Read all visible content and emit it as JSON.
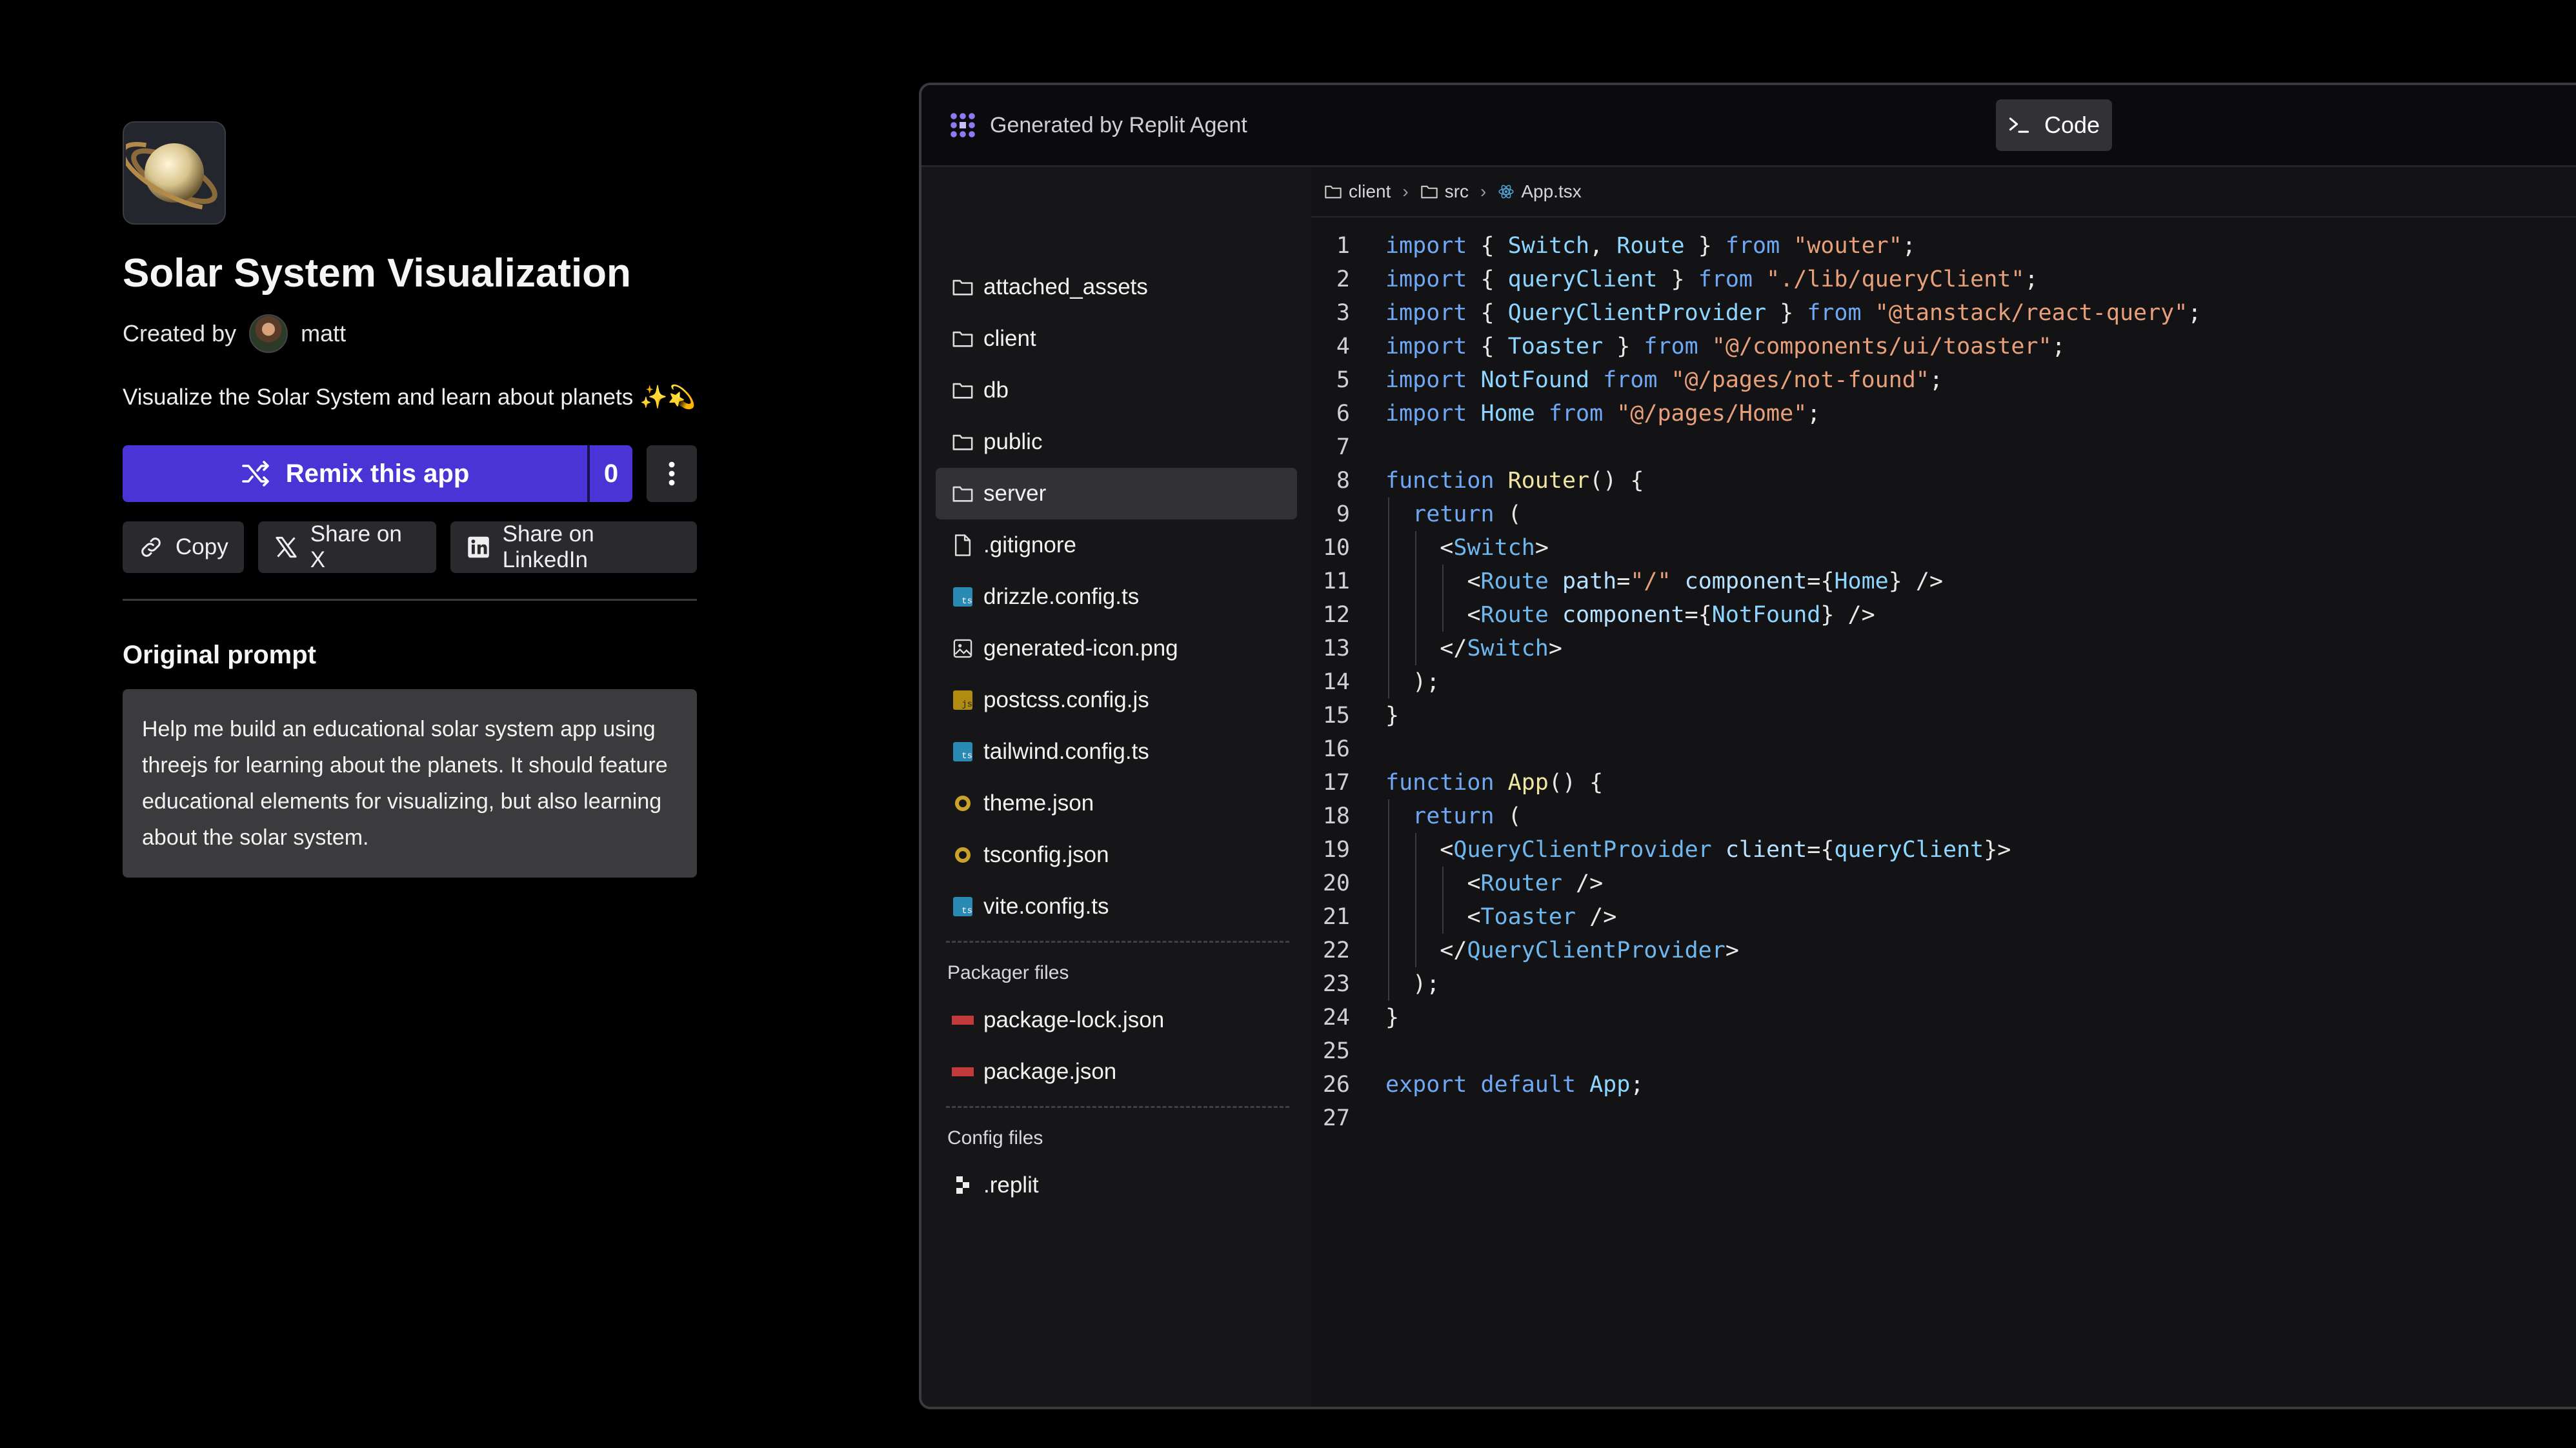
{
  "app": {
    "title": "Solar System Visualization",
    "created_by_label": "Created by",
    "author": "matt",
    "description": "Visualize the Solar System and learn about planets ✨💫",
    "remix_label": "Remix this app",
    "remix_count": "0",
    "share": {
      "copy": "Copy",
      "x": "Share on X",
      "linkedin": "Share on LinkedIn"
    },
    "prompt_heading": "Original prompt",
    "prompt_text": "Help me build an educational solar system app using threejs for learning about the planets. It should feature educational elements for visualizing, but also learning about the solar system."
  },
  "window": {
    "brand": "Generated by Replit Agent",
    "code_button": "Code"
  },
  "files": [
    {
      "name": "attached_assets",
      "icon": "folder-icon"
    },
    {
      "name": "client",
      "icon": "folder-icon"
    },
    {
      "name": "db",
      "icon": "folder-icon"
    },
    {
      "name": "public",
      "icon": "folder-icon"
    },
    {
      "name": "server",
      "icon": "folder-icon",
      "selected": true
    },
    {
      "name": ".gitignore",
      "icon": "file-icon"
    },
    {
      "name": "drizzle.config.ts",
      "icon": "typescript-icon"
    },
    {
      "name": "generated-icon.png",
      "icon": "image-icon"
    },
    {
      "name": "postcss.config.js",
      "icon": "javascript-icon"
    },
    {
      "name": "tailwind.config.ts",
      "icon": "typescript-icon"
    },
    {
      "name": "theme.json",
      "icon": "json-icon"
    },
    {
      "name": "tsconfig.json",
      "icon": "json-icon"
    },
    {
      "name": "vite.config.ts",
      "icon": "typescript-icon"
    }
  ],
  "packager": {
    "label": "Packager files",
    "files": [
      {
        "name": "package-lock.json",
        "icon": "npm-icon"
      },
      {
        "name": "package.json",
        "icon": "npm-icon"
      }
    ]
  },
  "config": {
    "label": "Config files",
    "files": [
      {
        "name": ".replit",
        "icon": "replit-icon"
      }
    ]
  },
  "breadcrumb": [
    "client",
    "src",
    "App.tsx"
  ],
  "code_lines": [
    "import { Switch, Route } from \"wouter\";",
    "import { queryClient } from \"./lib/queryClient\";",
    "import { QueryClientProvider } from \"@tanstack/react-query\";",
    "import { Toaster } from \"@/components/ui/toaster\";",
    "import NotFound from \"@/pages/not-found\";",
    "import Home from \"@/pages/Home\";",
    "",
    "function Router() {",
    "  return (",
    "    <Switch>",
    "      <Route path=\"/\" component={Home} />",
    "      <Route component={NotFound} />",
    "    </Switch>",
    "  );",
    "}",
    "",
    "function App() {",
    "  return (",
    "    <QueryClientProvider client={queryClient}>",
    "      <Router />",
    "      <Toaster />",
    "    </QueryClientProvider>",
    "  );",
    "}",
    "",
    "export default App;",
    ""
  ]
}
